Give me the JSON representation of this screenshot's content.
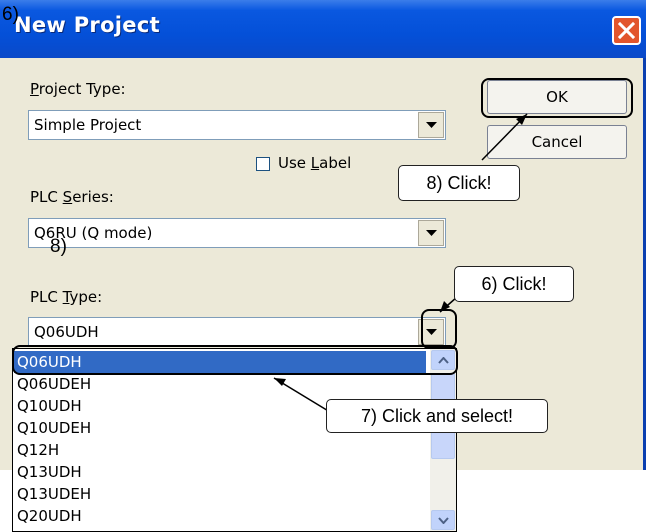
{
  "annotations": {
    "step_top": "6)",
    "step_mid": "8)",
    "click_ok": "8) Click!",
    "click_dropdown": "6) Click!",
    "click_select": "7) Click and select!"
  },
  "dialog": {
    "title": "New Project",
    "project_type_label": "Project Type:",
    "project_type_value": "Simple Project",
    "use_label": "Use Label",
    "use_label_checked": false,
    "plc_series_label": "PLC Series:",
    "plc_series_value": "Q6RU (Q mode)",
    "plc_type_label": "PLC Type:",
    "plc_type_value": "Q06UDH",
    "ok_label": "OK",
    "cancel_label": "Cancel"
  },
  "plc_type_options": [
    "Q06UDH",
    "Q06UDEH",
    "Q10UDH",
    "Q10UDEH",
    "Q12H",
    "Q13UDH",
    "Q13UDEH",
    "Q20UDH"
  ],
  "selected_option": "Q06UDH",
  "colors": {
    "title_bar": "#0a58e0",
    "selection": "#316ac5",
    "close": "#e2552c",
    "dialog_bg": "#ece9d8"
  },
  "icons": [
    "close-icon",
    "dropdown-arrow-icon",
    "scroll-up-icon",
    "scroll-down-icon"
  ]
}
